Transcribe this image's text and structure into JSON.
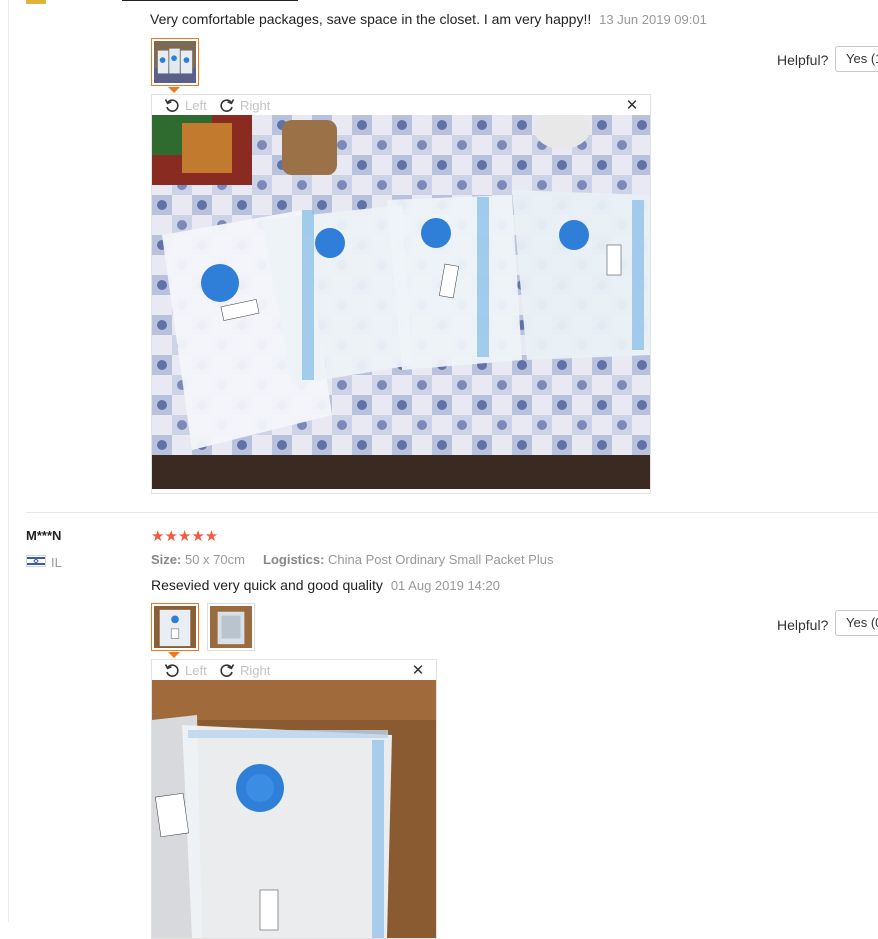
{
  "top_review": {
    "text": "Very comfortable packages, save space in the closet. I am very happy!!",
    "date": "13 Jun 2019 09:01",
    "viewer": {
      "left_label": "Left",
      "right_label": "Right",
      "close_symbol": "✕"
    },
    "helpful_label": "Helpful?",
    "yes_label": "Yes (1"
  },
  "review": {
    "user": "M***N",
    "country": "IL",
    "rating": 5,
    "stars": "★★★★★",
    "size_label": "Size:",
    "size_value": "50 x 70cm",
    "logistics_label": "Logistics:",
    "logistics_value": "China Post Ordinary Small Packet Plus",
    "text": "Resevied very quick and good quality",
    "date": "01 Aug 2019 14:20",
    "viewer": {
      "left_label": "Left",
      "right_label": "Right",
      "close_symbol": "✕"
    },
    "helpful_label": "Helpful?",
    "yes_label": "Yes (0"
  },
  "colors": {
    "accent_orange": "#f0791e",
    "star_red": "#f05a41",
    "muted_text": "#999999",
    "bag_blue": "#2f7fd8"
  }
}
